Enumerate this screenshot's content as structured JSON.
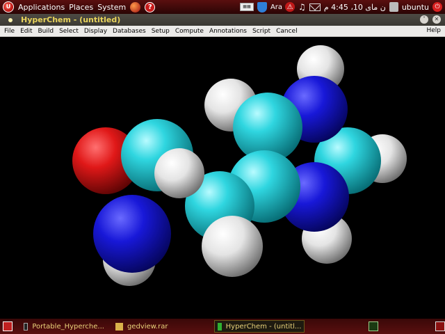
{
  "top_panel": {
    "menus": [
      "Applications",
      "Places",
      "System"
    ],
    "lang": "Ara",
    "clock": "ن مای 10، 4:45 م",
    "user": "ubuntu",
    "icons": [
      "distro-logo-icon",
      "firefox-icon",
      "help-icon",
      "keyboard-icon",
      "shield-icon",
      "network-icon",
      "volume-icon",
      "mail-icon",
      "user-icon",
      "power-icon"
    ]
  },
  "window": {
    "title": "HyperChem - (untitled)"
  },
  "menubar": {
    "items": [
      "File",
      "Edit",
      "Build",
      "Select",
      "Display",
      "Databases",
      "Setup",
      "Compute",
      "Annotations",
      "Script",
      "Cancel"
    ],
    "help": "Help"
  },
  "taskbar": {
    "tasks": [
      {
        "label": "Portable_Hyperche..."
      },
      {
        "label": "gedview.rar"
      },
      {
        "label": "HyperChem - (untitl..."
      }
    ]
  },
  "colors": {
    "carbon": "#19c8d2",
    "nitrogen": "#1a1ad0",
    "oxygen": "#e01818",
    "hydrogen": "#e8e8e8",
    "panel": "#4a0c0c"
  }
}
